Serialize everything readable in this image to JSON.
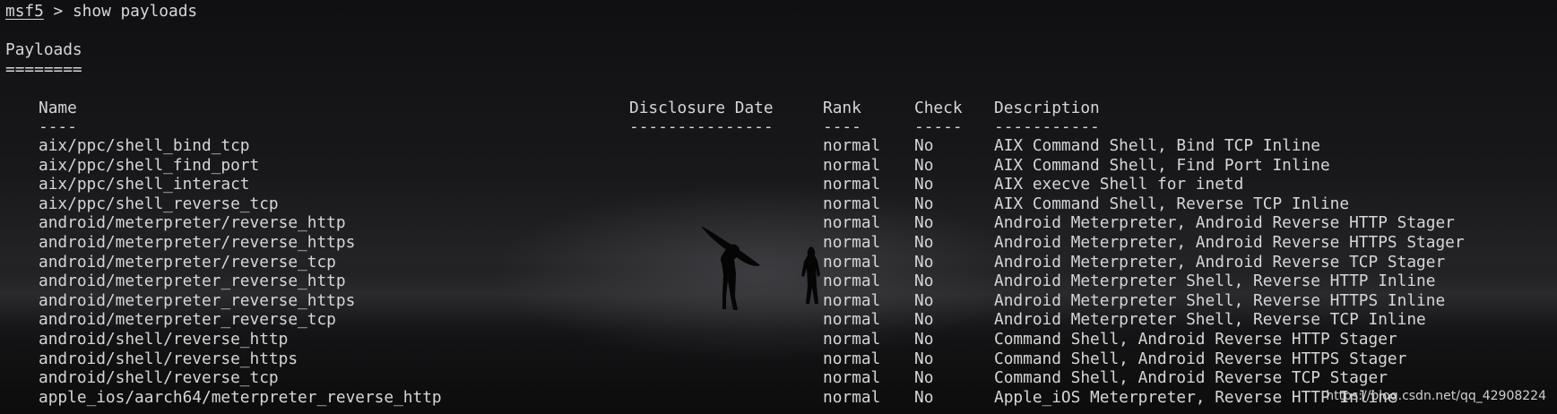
{
  "prompt": {
    "name": "msf5",
    "separator": " > ",
    "command": "show payloads"
  },
  "section": {
    "title": "Payloads",
    "underline": "========"
  },
  "table": {
    "headers": {
      "name": "Name",
      "date": "Disclosure Date",
      "rank": "Rank",
      "check": "Check",
      "description": "Description"
    },
    "dividers": {
      "name": "----",
      "date": "---------------",
      "rank": "----",
      "check": "-----",
      "description": "-----------"
    },
    "rows": [
      {
        "name": "aix/ppc/shell_bind_tcp",
        "date": "",
        "rank": "normal",
        "check": "No",
        "description": "AIX Command Shell, Bind TCP Inline"
      },
      {
        "name": "aix/ppc/shell_find_port",
        "date": "",
        "rank": "normal",
        "check": "No",
        "description": "AIX Command Shell, Find Port Inline"
      },
      {
        "name": "aix/ppc/shell_interact",
        "date": "",
        "rank": "normal",
        "check": "No",
        "description": "AIX execve Shell for inetd"
      },
      {
        "name": "aix/ppc/shell_reverse_tcp",
        "date": "",
        "rank": "normal",
        "check": "No",
        "description": "AIX Command Shell, Reverse TCP Inline"
      },
      {
        "name": "android/meterpreter/reverse_http",
        "date": "",
        "rank": "normal",
        "check": "No",
        "description": "Android Meterpreter, Android Reverse HTTP Stager"
      },
      {
        "name": "android/meterpreter/reverse_https",
        "date": "",
        "rank": "normal",
        "check": "No",
        "description": "Android Meterpreter, Android Reverse HTTPS Stager"
      },
      {
        "name": "android/meterpreter/reverse_tcp",
        "date": "",
        "rank": "normal",
        "check": "No",
        "description": "Android Meterpreter, Android Reverse TCP Stager"
      },
      {
        "name": "android/meterpreter_reverse_http",
        "date": "",
        "rank": "normal",
        "check": "No",
        "description": "Android Meterpreter Shell, Reverse HTTP Inline"
      },
      {
        "name": "android/meterpreter_reverse_https",
        "date": "",
        "rank": "normal",
        "check": "No",
        "description": "Android Meterpreter Shell, Reverse HTTPS Inline"
      },
      {
        "name": "android/meterpreter_reverse_tcp",
        "date": "",
        "rank": "normal",
        "check": "No",
        "description": "Android Meterpreter Shell, Reverse TCP Inline"
      },
      {
        "name": "android/shell/reverse_http",
        "date": "",
        "rank": "normal",
        "check": "No",
        "description": "Command Shell, Android Reverse HTTP Stager"
      },
      {
        "name": "android/shell/reverse_https",
        "date": "",
        "rank": "normal",
        "check": "No",
        "description": "Command Shell, Android Reverse HTTPS Stager"
      },
      {
        "name": "android/shell/reverse_tcp",
        "date": "",
        "rank": "normal",
        "check": "No",
        "description": "Command Shell, Android Reverse TCP Stager"
      },
      {
        "name": "apple_ios/aarch64/meterpreter_reverse_http",
        "date": "",
        "rank": "normal",
        "check": "No",
        "description": "Apple_iOS Meterpreter, Reverse HTTP Inline"
      }
    ]
  },
  "watermark": "https://blog.csdn.net/qq_42908224",
  "colors": {
    "text": "#d6d6d6",
    "background": "#0b0b0c"
  }
}
